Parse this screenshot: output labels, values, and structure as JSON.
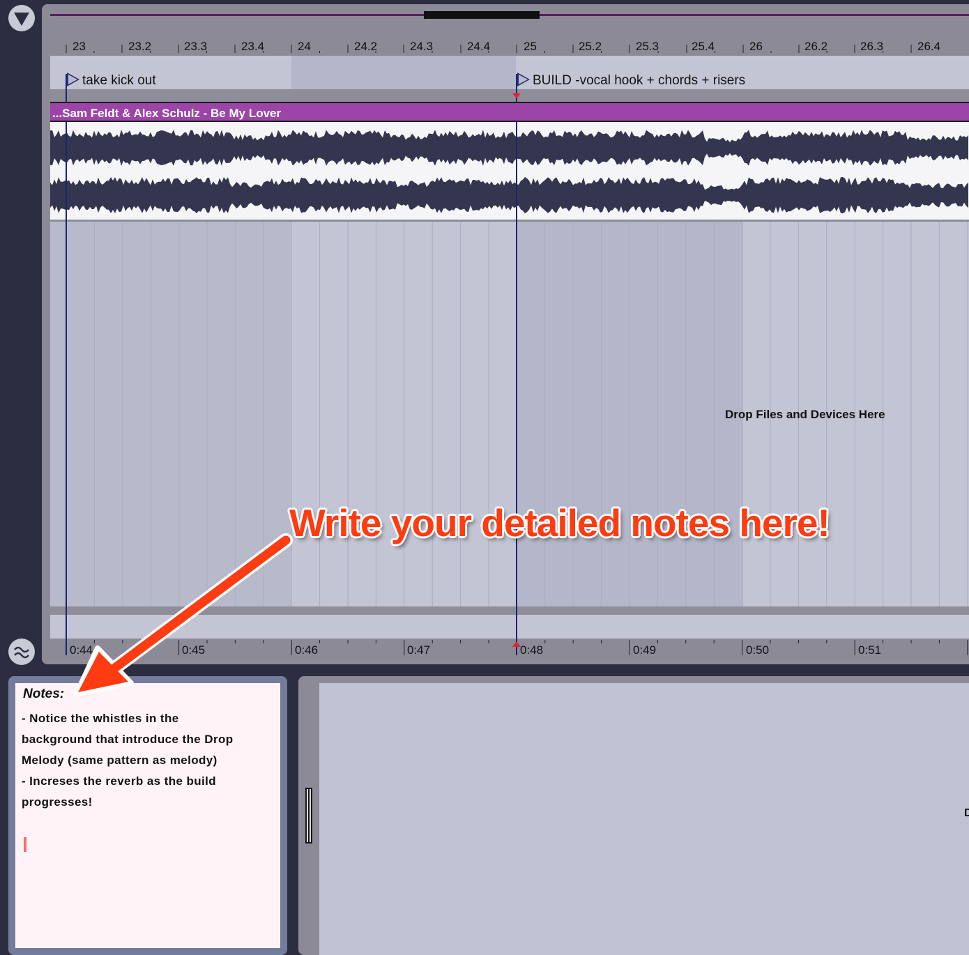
{
  "arrangement": {
    "bar_labels": [
      "23",
      "23.2",
      "23.3",
      "23.4",
      "24",
      "24.2",
      "24.3",
      "24.4",
      "25",
      "25.2",
      "25.3",
      "25.4",
      "26",
      "26.2",
      "26.3",
      "26.4"
    ],
    "time_labels": [
      "0:44",
      "0:45",
      "0:46",
      "0:47",
      "0:48",
      "0:49",
      "0:50",
      "0:51"
    ],
    "locators": [
      {
        "name": "take kick out"
      },
      {
        "name": "BUILD -vocal hook + chords + risers"
      }
    ],
    "clip": {
      "name": "...Sam Feldt & Alex Schulz - Be My Lover",
      "color": "#9c45a8"
    },
    "drop_hint": "Drop Files and Devices Here",
    "colors": {
      "lane_light": "#c1c3d3",
      "lane_dark": "#b3b6c8",
      "waveform": "#33364e",
      "playhead": "#1c2474",
      "marker": "#e8203a"
    }
  },
  "annotation": {
    "text": "Write your detailed notes here!",
    "color": "#ff3b12"
  },
  "notes": {
    "title": "Notes:",
    "lines": [
      "- Notice the whistles in the",
      "background that introduce the Drop",
      "Melody (same pattern as melody)",
      "- Increses the reverb as the build",
      "progresses!"
    ]
  },
  "detail_view": {
    "partial_label": "D"
  },
  "icons": {
    "top_toggle": "triangle-down-icon",
    "bottom_toggle": "waveform-toggle-icon",
    "fader": "fader-handle-icon"
  }
}
